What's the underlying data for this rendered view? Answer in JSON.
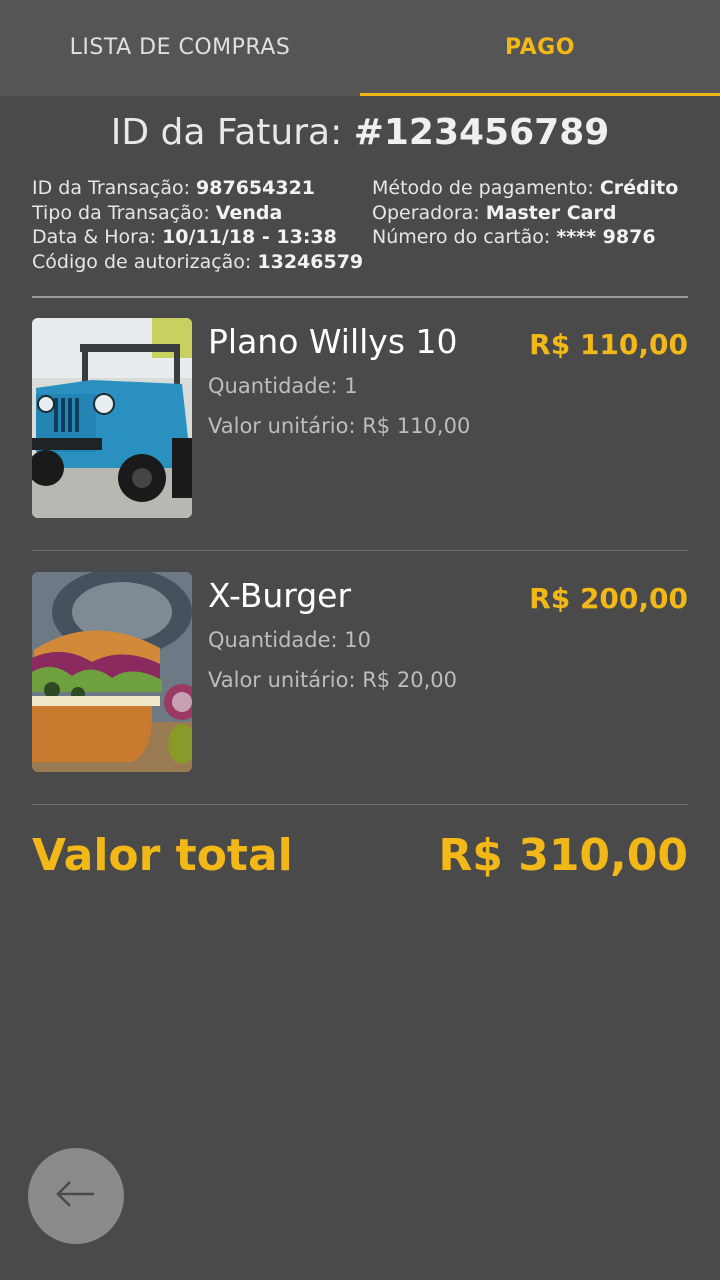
{
  "tabs": [
    {
      "label": "LISTA DE COMPRAS",
      "active": false
    },
    {
      "label": "PAGO",
      "active": true
    }
  ],
  "invoice": {
    "label": "ID da Fatura:",
    "id": "#123456789"
  },
  "details_left": [
    {
      "label": "ID da Transação:",
      "value": "987654321"
    },
    {
      "label": "Tipo da Transação:",
      "value": "Venda"
    },
    {
      "label": "Data & Hora:",
      "value": "10/11/18 - 13:38"
    },
    {
      "label": "Código de autorização:",
      "value": "13246579"
    }
  ],
  "details_right": [
    {
      "label": "Método de pagamento:",
      "value": "Crédito"
    },
    {
      "label": "Operadora:",
      "value": "Master Card"
    },
    {
      "label": "Número do cartão:",
      "value": "**** 9876"
    }
  ],
  "items": [
    {
      "name": "Plano Willys 10",
      "price": "R$ 110,00",
      "quantity": "Quantidade: 1",
      "unit_price": "Valor unitário: R$ 110,00",
      "image": "blue-jeep-photo"
    },
    {
      "name": "X-Burger",
      "price": "R$ 200,00",
      "quantity": "Quantidade: 10",
      "unit_price": "Valor unitário: R$ 20,00",
      "image": "burger-photo"
    }
  ],
  "total": {
    "label": "Valor total",
    "value": "R$ 310,00"
  },
  "back_button": {
    "icon": "arrow-left-icon"
  },
  "colors": {
    "background": "#4a4a4a",
    "tab_bar": "#555555",
    "accent": "#f2b817",
    "back_button": "#8a8a8a"
  }
}
